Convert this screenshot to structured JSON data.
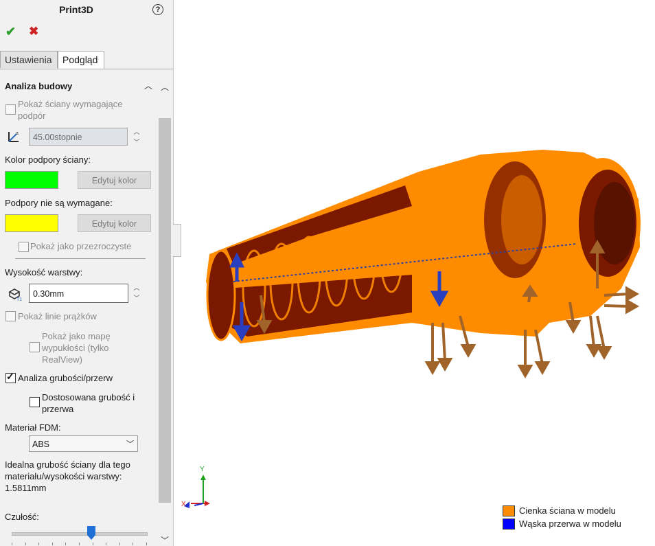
{
  "panel": {
    "title": "Print3D",
    "tabs": [
      "Ustawienia",
      "Podgląd"
    ],
    "section_title": "Analiza budowy",
    "show_support_faces": {
      "label": "Pokaż ściany wymagające podpór",
      "checked": false
    },
    "angle_value": "45.00stopnie",
    "support_color_label": "Kolor podpory ściany:",
    "support_color": "#00ff00",
    "edit_color_1": "Edytuj kolor",
    "no_support_label": "Podpory nie są wymagane:",
    "no_support_color": "#ffff00",
    "edit_color_2": "Edytuj kolor",
    "show_transparent": "Pokaż jako przezroczyste",
    "layer_height_label": "Wysokość warstwy:",
    "layer_height_value": "0.30mm",
    "show_stripes": "Pokaż linie prążków",
    "show_curvature": "Pokaż jako mapę wypukłości (tylko RealView)",
    "thickness_analysis": {
      "label": "Analiza grubości/przerw",
      "checked": true
    },
    "custom_thickness": {
      "label": "Dostosowana grubość i przerwa",
      "checked": false
    },
    "material_label": "Materiał FDM:",
    "material_value": "ABS",
    "ideal_thickness": "Idealna grubość ściany dla tego materiału/wysokości warstwy: 1.5811mm",
    "sensitivity_label": "Czułość:",
    "sensitivity_level": 0.59
  },
  "legend": [
    {
      "label": "Cienka ściana w modelu",
      "color": "#ff8c00"
    },
    {
      "label": "Wąska przerwa w modelu",
      "color": "#0000ff"
    }
  ],
  "triad": {
    "x": "X",
    "y": "Y"
  },
  "colors": {
    "body": "#ff8c00",
    "interior": "#7a1800",
    "arrows": "#a0642a",
    "gap_arrows": "#2a3fbf"
  }
}
